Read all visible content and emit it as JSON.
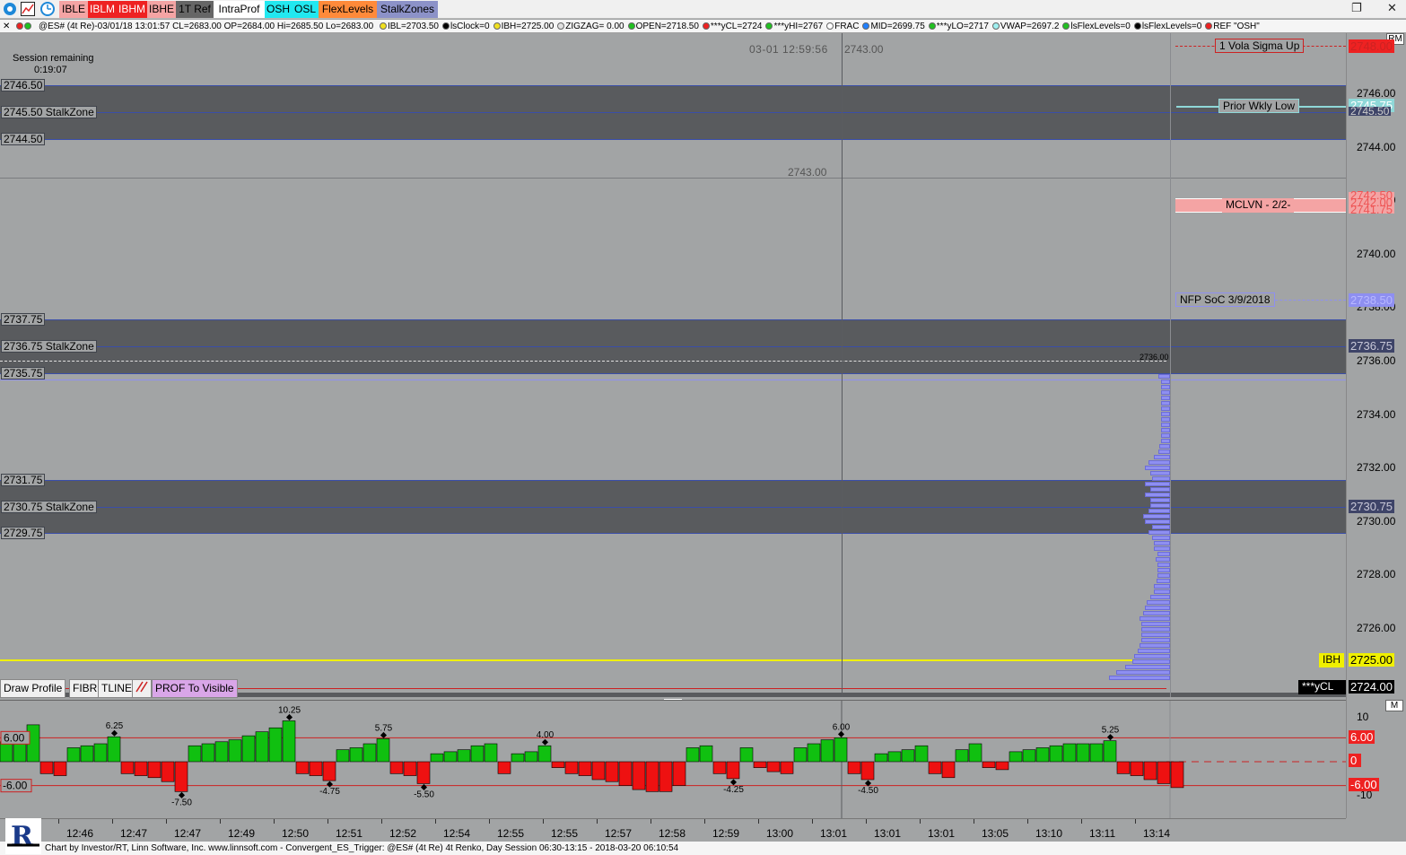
{
  "toolbar": {
    "buttons": [
      {
        "label": "IBLE",
        "bg": "#f4a4a4",
        "fg": "#000000"
      },
      {
        "label": "IBLM",
        "bg": "#ee2222",
        "fg": "#ffffff"
      },
      {
        "label": "IBHM",
        "bg": "#ee2222",
        "fg": "#ffffff"
      },
      {
        "label": "IBHE",
        "bg": "#f4a4a4",
        "fg": "#000000"
      },
      {
        "label": "1T Ref",
        "bg": "#666666",
        "fg": "#000000"
      },
      {
        "label": "IntraProf",
        "bg": "#ffffff",
        "fg": "#000000"
      },
      {
        "label": "OSH",
        "bg": "#22e8f0",
        "fg": "#000000"
      },
      {
        "label": "OSL",
        "bg": "#22e8f0",
        "fg": "#000000"
      },
      {
        "label": "FlexLevels",
        "bg": "#ff8a3a",
        "fg": "#000000"
      },
      {
        "label": "StalkZones",
        "bg": "#8c92c8",
        "fg": "#000000"
      }
    ]
  },
  "status": {
    "symbol": "@ES# (4t Re)-03/01/18 13:01:57 CL=2683.00 OP=2684.00 Hi=2685.50 Lo=2683.00",
    "items": [
      {
        "text": "IBL=2703.50",
        "color": "#f0e020"
      },
      {
        "text": "lsClock=0",
        "color": "#000000"
      },
      {
        "text": "IBH=2725.00",
        "color": "#f0e020"
      },
      {
        "text": "ZIGZAG= 0.00",
        "color": "#e0e0e0"
      },
      {
        "text": "OPEN=2718.50",
        "color": "#20c020"
      },
      {
        "text": "***yCL=2724",
        "color": "#ee2222"
      },
      {
        "text": "***yHI=2767",
        "color": "#20c020"
      },
      {
        "text": "FRAC",
        "color": "#ffffff"
      },
      {
        "text": "MID=2699.75",
        "color": "#2080ff"
      },
      {
        "text": "***yLO=2717",
        "color": "#20c020"
      },
      {
        "text": "VWAP=2697.2",
        "color": "#a0f0f0"
      },
      {
        "text": "lsFlexLevels=0",
        "color": "#20c020"
      },
      {
        "text": "lsFlexLevels=0",
        "color": "#000000"
      },
      {
        "text": "REF \"OSH\"",
        "color": "#ee2222"
      }
    ]
  },
  "session": {
    "label": "Session remaining",
    "time": "0:19:07"
  },
  "crosshair": {
    "datetime": "03-01 12:59:56",
    "price": "2743.00",
    "price2": "2743.00"
  },
  "levels": {
    "z1_top": "2746.50",
    "z1_mid": "2745.50 StalkZone",
    "z1_bot": "2744.50",
    "z2_top": "2737.75",
    "z2_mid": "2736.75 StalkZone",
    "z2_bot": "2735.75",
    "z3_top": "2731.75",
    "z3_mid": "2730.75 StalkZone",
    "z3_bot": "2729.75"
  },
  "price_axis": {
    "ticks": [
      "2746.00",
      "2744.00",
      "2742.00",
      "2740.00",
      "2738.00",
      "2736.00",
      "2734.00",
      "2732.00",
      "2730.00",
      "2728.00",
      "2726.00"
    ],
    "tags": {
      "vola": "2748.00",
      "wkly": "2745.75",
      "wkly2": "2745.50",
      "mclvn1": "2742.50",
      "mclvn2": "2742.00",
      "mclvn3": "2741.75",
      "nfp": "2738.50",
      "stalk2": "2736.75",
      "stalk3": "2730.75",
      "ibh": "2725.00",
      "ycl": "2724.00"
    },
    "rm": "RM"
  },
  "notes": {
    "vola": "1 Vola Sigma Up",
    "wkly": "Prior Wkly Low",
    "mclvn": "MCLVN - 2/2-",
    "nfp": "NFP SoC 3/9/2018",
    "ibh": "IBH",
    "ycl": "***yCL",
    "prof_top": "2736.00"
  },
  "profile": {
    "bars": [
      13,
      10,
      10,
      10,
      10,
      10,
      10,
      10,
      10,
      10,
      10,
      10,
      10,
      12,
      13,
      18,
      24,
      28,
      22,
      20,
      28,
      22,
      28,
      22,
      22,
      24,
      30,
      28,
      20,
      24,
      20,
      18,
      18,
      14,
      16,
      14,
      14,
      14,
      15,
      18,
      18,
      22,
      26,
      28,
      30,
      34,
      32,
      32,
      32,
      32,
      34,
      36,
      40,
      42,
      50,
      60,
      68
    ]
  },
  "buttons": {
    "draw": "Draw Profile",
    "fibr": "FIBR",
    "tline": "TLINE",
    "prof": "PROF To Visible"
  },
  "osc": {
    "upper": "6.00",
    "lower": "-6.00",
    "zero": "0",
    "axis": {
      "p10": "10",
      "m10": "-10",
      "m": "M",
      "tag_up": "6.00",
      "tag_zero": "0",
      "tag_dn": "-6.00"
    },
    "values": [
      5,
      7.5,
      9.25,
      -3,
      -3.5,
      3.5,
      4,
      4.5,
      6.25,
      -3,
      -3.5,
      -4,
      -5,
      -7.5,
      4,
      4.5,
      5,
      5.5,
      6.5,
      7.5,
      8.5,
      10.25,
      -3,
      -3.5,
      -4.75,
      3,
      3.5,
      4.5,
      5.75,
      -3,
      -3.5,
      -5.5,
      2,
      2.5,
      3,
      4,
      4.5,
      -3,
      2,
      2.5,
      4,
      -1.5,
      -3,
      -3.5,
      -4.5,
      -5,
      -6,
      -7,
      -7.5,
      -7.5,
      -6,
      3.5,
      4,
      -3,
      -4.25,
      3.5,
      -1.5,
      -2.5,
      -3,
      3.5,
      4.5,
      5.5,
      6,
      -3,
      -4.5,
      2,
      2.5,
      3,
      4,
      -3,
      -4,
      3,
      4.5,
      -1.5,
      -2,
      2.5,
      3,
      3.5,
      4,
      4.5,
      4.5,
      4.5,
      5.25,
      -3,
      -3.5,
      -4.5,
      -5.5,
      -6.5
    ],
    "labels": [
      {
        "i": 8,
        "t": "6.25"
      },
      {
        "i": 13,
        "t": "-7.50"
      },
      {
        "i": 21,
        "t": "10.25"
      },
      {
        "i": 24,
        "t": "-4.75"
      },
      {
        "i": 28,
        "t": "5.75"
      },
      {
        "i": 31,
        "t": "-5.50"
      },
      {
        "i": 40,
        "t": "4.00"
      },
      {
        "i": 54,
        "t": "-4.25"
      },
      {
        "i": 62,
        "t": "6.00"
      },
      {
        "i": 64,
        "t": "-4.50"
      },
      {
        "i": 82,
        "t": "5.25"
      }
    ]
  },
  "time_axis": [
    "12:46",
    "12:47",
    "12:47",
    "12:49",
    "12:50",
    "12:51",
    "12:52",
    "12:54",
    "12:55",
    "12:55",
    "12:57",
    "12:58",
    "12:59",
    "13:00",
    "13:01",
    "13:01",
    "13:01",
    "13:05",
    "13:10",
    "13:11",
    "13:14"
  ],
  "footer": "Chart by Investor/RT, Linn Software, Inc. www.linnsoft.com - Convergent_ES_Trigger: @ES# (4t Re) 4t Renko, Day Session 06:30-13:15 - 2018-03-20 06:10:54",
  "colors": {
    "zone": "#595b5e",
    "bg": "#a2a4a5",
    "ibh": "#f0f000",
    "green": "#10c010",
    "red": "#ee1111",
    "profile": "#8e8ff1"
  }
}
